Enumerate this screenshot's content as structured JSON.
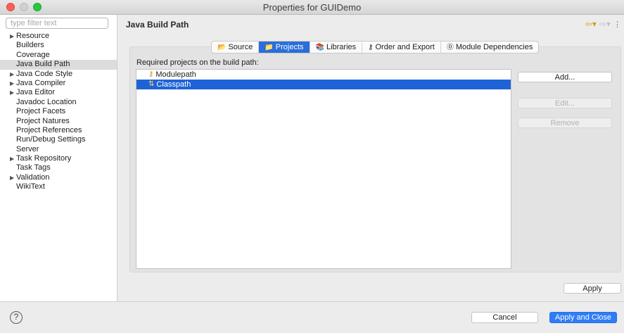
{
  "window": {
    "title": "Properties for GUIDemo"
  },
  "sidebar": {
    "filter_placeholder": "type filter text",
    "items": [
      {
        "label": "Resource",
        "expandable": true
      },
      {
        "label": "Builders",
        "expandable": false
      },
      {
        "label": "Coverage",
        "expandable": false
      },
      {
        "label": "Java Build Path",
        "expandable": false,
        "selected": true
      },
      {
        "label": "Java Code Style",
        "expandable": true
      },
      {
        "label": "Java Compiler",
        "expandable": true
      },
      {
        "label": "Java Editor",
        "expandable": true
      },
      {
        "label": "Javadoc Location",
        "expandable": false
      },
      {
        "label": "Project Facets",
        "expandable": false
      },
      {
        "label": "Project Natures",
        "expandable": false
      },
      {
        "label": "Project References",
        "expandable": false
      },
      {
        "label": "Run/Debug Settings",
        "expandable": false
      },
      {
        "label": "Server",
        "expandable": false
      },
      {
        "label": "Task Repository",
        "expandable": true
      },
      {
        "label": "Task Tags",
        "expandable": false
      },
      {
        "label": "Validation",
        "expandable": true
      },
      {
        "label": "WikiText",
        "expandable": false
      }
    ]
  },
  "main": {
    "title": "Java Build Path",
    "tabs": [
      {
        "label": "Source",
        "icon": "source-folder-icon"
      },
      {
        "label": "Projects",
        "icon": "projects-folder-icon",
        "active": true
      },
      {
        "label": "Libraries",
        "icon": "libraries-icon"
      },
      {
        "label": "Order and Export",
        "icon": "order-export-icon"
      },
      {
        "label": "Module Dependencies",
        "icon": "module-icon"
      }
    ],
    "required_label": "Required projects on the build path:",
    "entries": [
      {
        "label": "Modulepath",
        "icon": "modulepath-icon"
      },
      {
        "label": "Classpath",
        "icon": "classpath-icon",
        "selected": true
      }
    ],
    "buttons": {
      "add": "Add...",
      "edit": "Edit...",
      "remove": "Remove",
      "apply": "Apply"
    }
  },
  "footer": {
    "cancel": "Cancel",
    "apply_close": "Apply and Close",
    "help": "?"
  }
}
